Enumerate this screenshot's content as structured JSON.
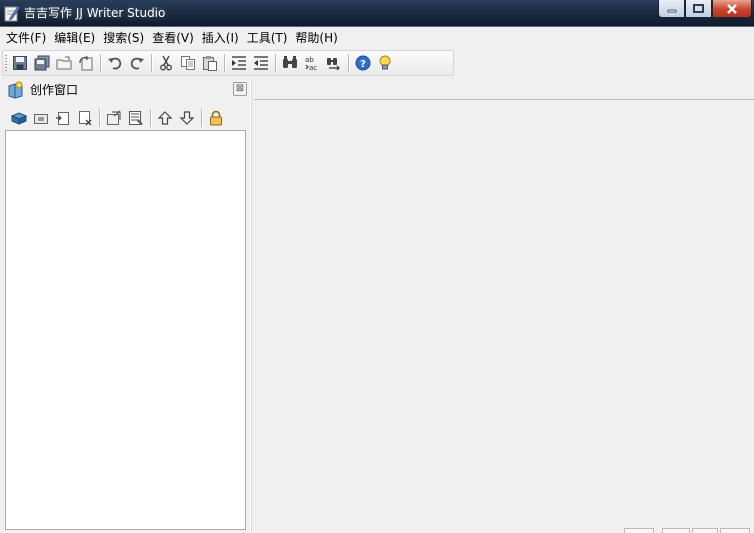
{
  "window": {
    "title": "吉吉写作 JJ Writer Studio"
  },
  "menu": [
    {
      "label": "文件(F)"
    },
    {
      "label": "编辑(E)"
    },
    {
      "label": "搜索(S)"
    },
    {
      "label": "查看(V)"
    },
    {
      "label": "插入(I)"
    },
    {
      "label": "工具(T)"
    },
    {
      "label": "帮助(H)"
    }
  ],
  "toolbar": {
    "groups": [
      [
        "save-icon",
        "save-all-icon",
        "open-folder-icon",
        "reload-icon"
      ],
      [
        "undo-icon",
        "redo-icon"
      ],
      [
        "cut-icon",
        "copy-icon",
        "paste-icon"
      ],
      [
        "indent-increase-icon",
        "indent-decrease-icon"
      ],
      [
        "find-icon",
        "replace-icon",
        "find-next-icon"
      ],
      [
        "help-icon",
        "tip-icon"
      ]
    ]
  },
  "pane": {
    "title": "创作窗口",
    "close_glyph": "⊠",
    "toolbar": [
      [
        "new-book-icon",
        "new-folder-icon",
        "new-chapter-icon",
        "delete-icon"
      ],
      [
        "properties-icon",
        "outline-icon"
      ],
      [
        "move-up-icon",
        "move-down-icon"
      ],
      [
        "lock-icon"
      ]
    ]
  },
  "colors": {
    "titlebar": "#1d2c44",
    "close": "#c8452b",
    "background": "#f0f0f0"
  }
}
